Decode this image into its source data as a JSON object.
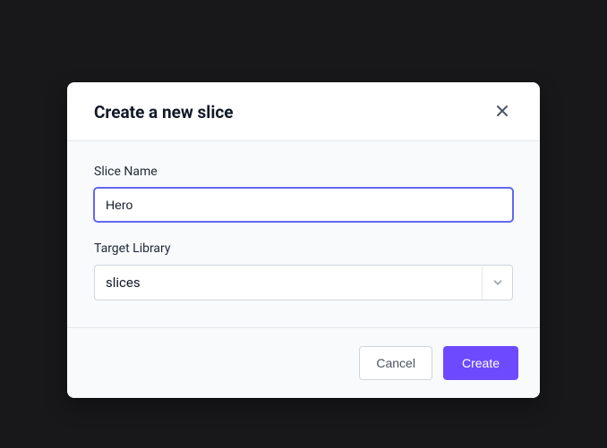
{
  "modal": {
    "title": "Create a new slice",
    "fields": {
      "slice_name": {
        "label": "Slice Name",
        "value": "Hero"
      },
      "target_library": {
        "label": "Target Library",
        "value": "slices"
      }
    },
    "buttons": {
      "cancel": "Cancel",
      "create": "Create"
    }
  }
}
